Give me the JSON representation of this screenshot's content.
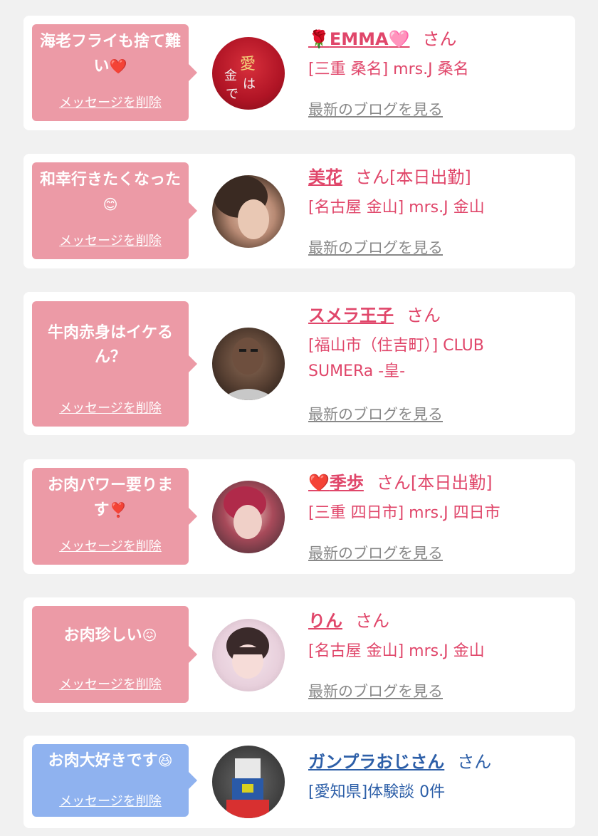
{
  "entries": [
    {
      "bubble": {
        "message": "海老フライも捨て難い",
        "emoji": "❤️",
        "delete": "メッセージを削除"
      },
      "name": "EMMA",
      "name_prefix_icon": "🌹",
      "name_suffix_icon": "🩷",
      "honorific": "さん",
      "status": "",
      "shop": "[三重 桑名] mrs.J 桑名",
      "blog": "最新のブログを見る"
    },
    {
      "bubble": {
        "message": "和幸行きたくなった",
        "emoji": "😊",
        "delete": "メッセージを削除"
      },
      "name": "美花",
      "name_prefix_icon": "",
      "name_suffix_icon": "",
      "honorific": "さん",
      "status": "[本日出勤]",
      "shop": "[名古屋 金山] mrs.J 金山",
      "blog": "最新のブログを見る"
    },
    {
      "bubble": {
        "message": "牛肉赤身はイケるん？",
        "emoji": "",
        "delete": "メッセージを削除"
      },
      "name": "スメラ王子",
      "name_prefix_icon": "",
      "name_suffix_icon": "",
      "honorific": "さん",
      "status": "",
      "shop_line1": "[福山市（住吉町）] CLUB",
      "shop_line2": "SUMERa -皇-",
      "blog": "最新のブログを見る"
    },
    {
      "bubble": {
        "message": "お肉パワー要ります",
        "emoji": "❣️",
        "delete": "メッセージを削除"
      },
      "name": "季歩",
      "name_prefix_icon": "❤️",
      "name_suffix_icon": "",
      "honorific": "さん",
      "status": "[本日出勤]",
      "shop": "[三重 四日市] mrs.J 四日市",
      "blog": "最新のブログを見る"
    },
    {
      "bubble": {
        "message": "お肉珍しい",
        "emoji": "😖",
        "delete": "メッセージを削除"
      },
      "name": "りん",
      "name_prefix_icon": "",
      "name_suffix_icon": "",
      "honorific": "さん",
      "status": "",
      "shop": "[名古屋 金山] mrs.J 金山",
      "blog": "最新のブログを見る"
    },
    {
      "bubble": {
        "message": "お肉大好きです",
        "emoji": "😆",
        "delete": "メッセージを削除"
      },
      "name": "ガンプラおじさん",
      "name_prefix_icon": "",
      "name_suffix_icon": "",
      "honorific": "さん",
      "status": "",
      "shop": "[愛知県]体験談 0件"
    }
  ],
  "colors": {
    "pink_bubble": "#ec9aa6",
    "blue_bubble": "#8fb2ef",
    "name_pink": "#e0466a",
    "name_blue": "#2d5fa8",
    "blog_gray": "#888888"
  }
}
